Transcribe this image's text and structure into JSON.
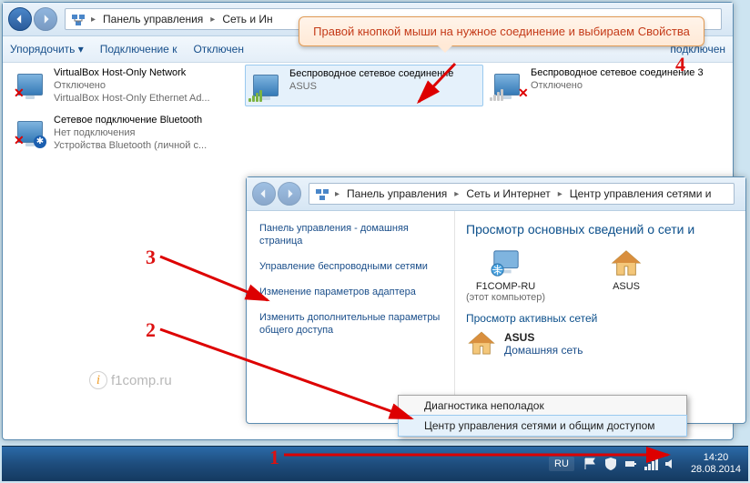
{
  "callout": {
    "text": "Правой кнопкой мыши на нужное соединение и выбираем Свойства"
  },
  "annot": {
    "n1": "1",
    "n2": "2",
    "n3": "3",
    "n4": "4"
  },
  "watermark": "f1comp.ru",
  "win1": {
    "breadcrumb": [
      "Панель управления",
      "Сеть и Ин"
    ],
    "search_placeholder": "",
    "toolbar": {
      "organize": "Упорядочить ▾",
      "connect": "Подключение к",
      "disconnect": "Отключен",
      "right": "подключен"
    },
    "items": [
      {
        "title": "VirtualBox Host-Only Network",
        "status": "Отключено",
        "sub": "VirtualBox Host-Only Ethernet Ad..."
      },
      {
        "title": "Беспроводное сетевое соединение",
        "status": "",
        "sub": "ASUS"
      },
      {
        "title": "Беспроводное сетевое соединение 3",
        "status": "Отключено",
        "sub": ""
      },
      {
        "title": "Сетевое подключение Bluetooth",
        "status": "Нет подключения",
        "sub": "Устройства Bluetooth (личной с..."
      }
    ]
  },
  "win2": {
    "breadcrumb": [
      "Панель управления",
      "Сеть и Интернет",
      "Центр управления сетями и"
    ],
    "side": {
      "home": "Панель управления - домашняя страница",
      "wireless": "Управление беспроводными сетями",
      "adapter": "Изменение параметров адаптера",
      "sharing": "Изменить дополнительные параметры общего доступа"
    },
    "heading": "Просмотр основных сведений о сети и",
    "pc": {
      "name": "F1COMP-RU",
      "sub": "(этот компьютер)"
    },
    "ap": {
      "name": "ASUS"
    },
    "active_label": "Просмотр активных сетей",
    "active": {
      "name": "ASUS",
      "type": "Домашняя сеть"
    }
  },
  "ctx": {
    "diag": "Диагностика неполадок",
    "center": "Центр управления сетями и общим доступом"
  },
  "tray": {
    "lang": "RU",
    "time": "14:20",
    "date": "28.08.2014"
  }
}
